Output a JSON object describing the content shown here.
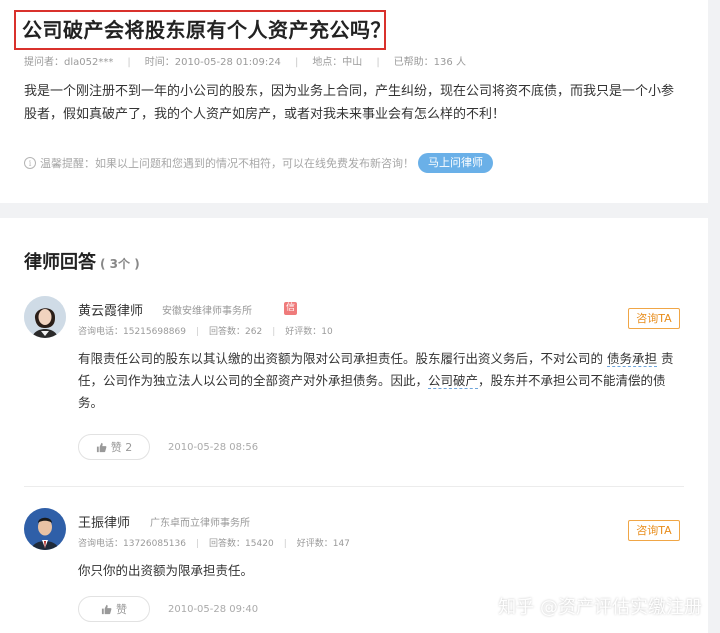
{
  "question": {
    "title": "公司破产会将股东原有个人资产充公吗？",
    "meta": {
      "asker": "提问者：dla052***",
      "time": "时间：2010-05-28 01:09:24",
      "location": "地点：中山",
      "helped": "已帮助：136 人"
    },
    "body": "我是一个刚注册不到一年的小公司的股东，因为业务上合同，产生纠纷，现在公司将资不底债，而我只是一个小参股者，假如真破产了，我的个人资产如房产，或者对我未来事业会有怎么样的不利！",
    "tip": "温馨提醒：如果以上问题和您遇到的情况不相符，可以在线免费发布新咨询！",
    "ask_button": "马上问律师"
  },
  "answers_section": {
    "heading": "律师回答",
    "count": "( 3个 )",
    "answers": [
      {
        "name": "黄云霞律师",
        "firm": "安徽安维律师事务所",
        "badge": "信",
        "phone": "咨询电话：15215698869",
        "answers_count": "回答数：262",
        "rating": "好评数：10",
        "consult": "咨询TA",
        "body_pre": "有限责任公司的股东以其认缴的出资额为限对公司承担责任。股东履行出资义务后，不对公司的 ",
        "link1": "债务承担",
        "body_mid": " 责任，公司作为独立法人以公司的全部资产对外承担债务。因此，",
        "link2": "公司破产",
        "body_post": "，股东并不承担公司不能清偿的债务。",
        "likes": "赞 2",
        "time": "2010-05-28 08:56"
      },
      {
        "name": "王振律师",
        "firm": "广东卓而立律师事务所",
        "phone": "咨询电话：13726085136",
        "answers_count": "回答数：15420",
        "rating": "好评数：147",
        "consult": "咨询TA",
        "body": "你只你的出资额为限承担责任。",
        "likes": "赞",
        "time": "2010-05-28 09:40"
      }
    ]
  },
  "watermark": "知乎 @资产评估实缴注册",
  "colors": {
    "highlight_border": "#d9312c",
    "ask_button_bg": "#6ab0e8",
    "consult_border": "#f0a646",
    "badge_bg": "#ef7b7b"
  },
  "icons": [
    "info-icon",
    "thumbs-up-icon",
    "avatar-photo"
  ]
}
